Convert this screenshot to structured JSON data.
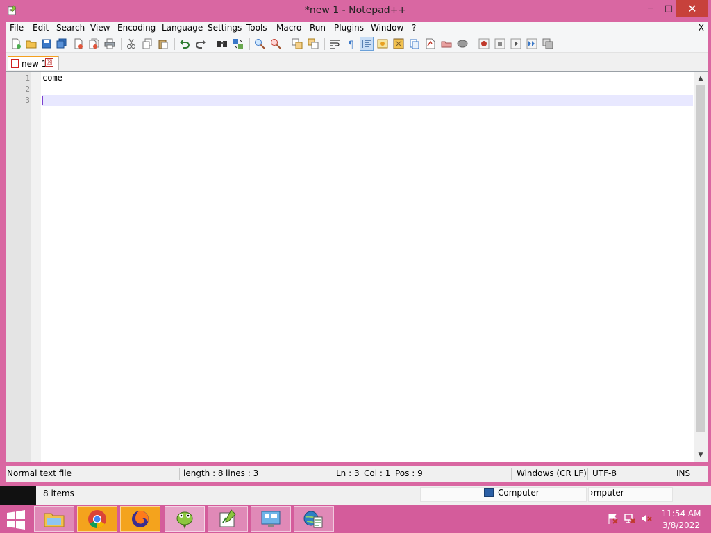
{
  "window": {
    "title": "*new 1 - Notepad++",
    "close_glyph": "✕",
    "max_glyph": "□",
    "min_glyph": "─"
  },
  "menubar": {
    "items": [
      "File",
      "Edit",
      "Search",
      "View",
      "Encoding",
      "Language",
      "Settings",
      "Tools",
      "Macro",
      "Run",
      "Plugins",
      "Window",
      "?"
    ],
    "close_label": "X"
  },
  "toolbar": {
    "icons": [
      "new-file-icon",
      "open-file-icon",
      "save-icon",
      "save-all-icon",
      "close-icon",
      "close-all-icon",
      "print-icon",
      "cut-icon",
      "copy-icon",
      "paste-icon",
      "undo-icon",
      "redo-icon",
      "find-icon",
      "replace-icon",
      "zoom-in-icon",
      "zoom-out-icon",
      "sync-vertical-icon",
      "sync-horizontal-icon",
      "word-wrap-icon",
      "show-all-chars-icon",
      "indent-guide-icon",
      "language-xml-icon",
      "doc-map-icon",
      "function-list-icon",
      "folder-workspace-icon",
      "monitoring-icon",
      "record-macro-icon",
      "stop-macro-icon",
      "play-macro-icon",
      "run-macro-multiple-icon",
      "save-macro-icon"
    ]
  },
  "tabs": [
    {
      "label": "new 1",
      "close_glyph": "☒"
    }
  ],
  "editor": {
    "lines": [
      {
        "number": "1",
        "text": "come"
      },
      {
        "number": "2",
        "text": ""
      },
      {
        "number": "3",
        "text": ""
      }
    ]
  },
  "statusbar": {
    "file_type": "Normal text file",
    "length": "length : 8",
    "lines": "lines : 3",
    "ln": "Ln : 3",
    "col": "Col : 1",
    "pos": "Pos : 9",
    "eol": "Windows (CR LF)",
    "encoding": "UTF-8",
    "mode": "INS"
  },
  "explorer": {
    "items_count": "8 items",
    "location": "Computer",
    "field2": "›mputer"
  },
  "taskbar": {
    "apps": [
      "file-explorer",
      "chrome",
      "firefox",
      "notepad-plus-plus",
      "task-editor",
      "control-panel",
      "network-globe"
    ],
    "active_app": "notepad-plus-plus",
    "time": "11:54 AM",
    "date": "3/8/2022"
  }
}
